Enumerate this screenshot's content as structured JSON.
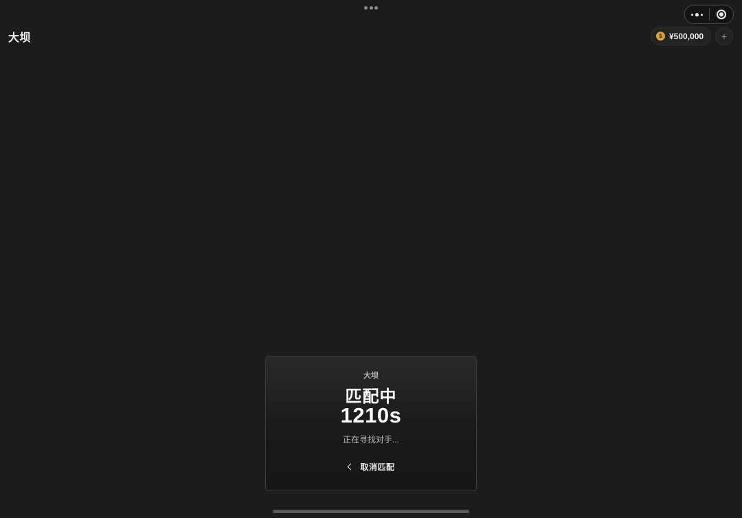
{
  "header": {
    "title": "大坝",
    "currency": {
      "icon": "coin-icon",
      "icon_glyph": "$",
      "amount": "¥500,000"
    },
    "add_icon": "plus-icon",
    "add_label": "+"
  },
  "capsule": {
    "menu_icon": "more-dots-icon",
    "close_icon": "target-icon"
  },
  "matchmaking": {
    "map_name": "大坝",
    "status": "匹配中",
    "timer": "1210s",
    "hint": "正在寻找对手...",
    "cancel_label": "取消匹配",
    "cancel_icon": "chevron-left-icon"
  },
  "colors": {
    "background": "#1c1c1c",
    "coin": "#d9a531",
    "text_primary": "#ffffff"
  }
}
